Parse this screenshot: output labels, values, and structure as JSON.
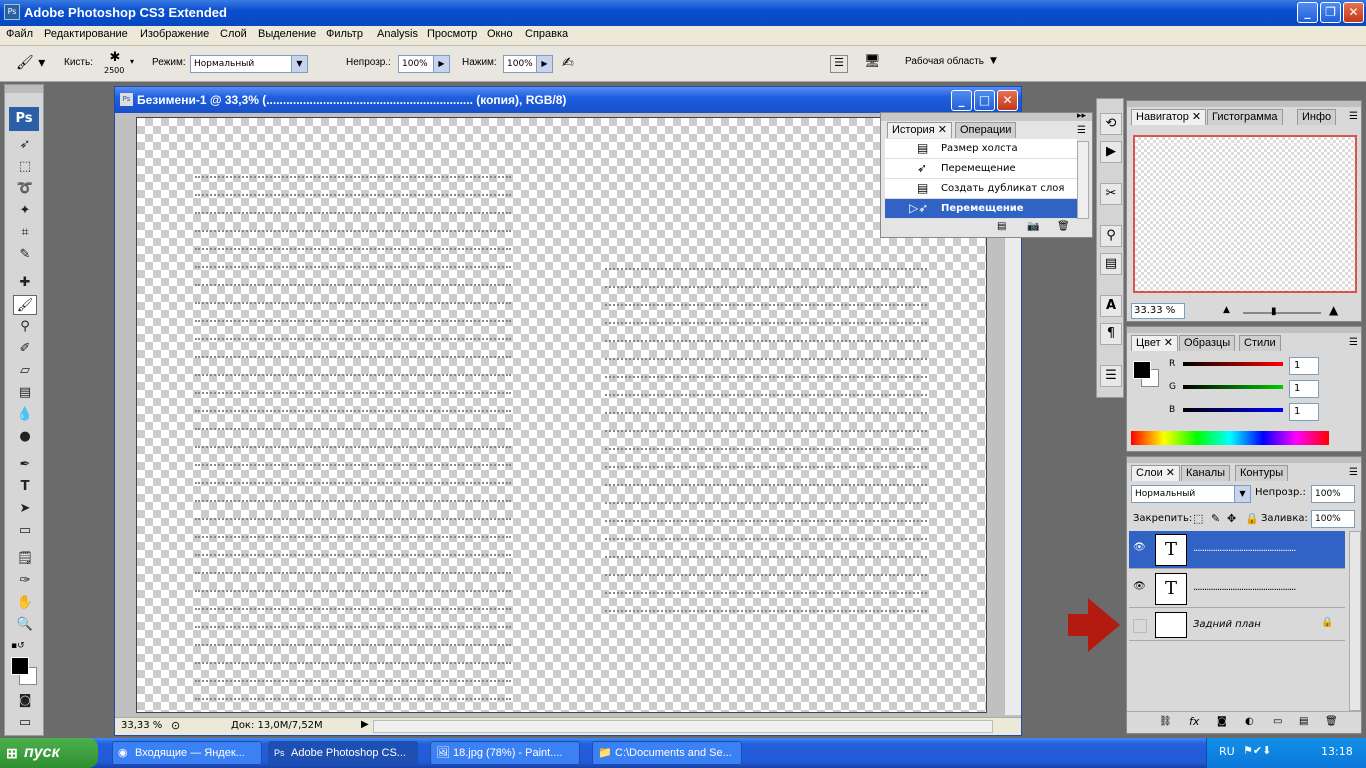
{
  "window": {
    "title": "Adobe Photoshop CS3 Extended",
    "logo": "Ps"
  },
  "menu": [
    "Файл",
    "Редактирование",
    "Изображение",
    "Слой",
    "Выделение",
    "Фильтр",
    "Analysis",
    "Просмотр",
    "Окно",
    "Справка"
  ],
  "options": {
    "brush_label": "Кисть:",
    "brush_size": "2500",
    "mode_label": "Режим:",
    "mode_value": "Нормальный",
    "opacity_label": "Непрозр.:",
    "opacity_value": "100%",
    "flow_label": "Нажим:",
    "flow_value": "100%",
    "workspace": "Рабочая область"
  },
  "document": {
    "title": "Безимени-1 @ 33,3% (.............................................................. (копия), RGB/8)",
    "zoom": "33,33 %",
    "doc_info": "Док: 13,0M/7,52M"
  },
  "history": {
    "tabs": [
      "История",
      "Операции"
    ],
    "items": [
      {
        "label": "Размер холста",
        "selected": false
      },
      {
        "label": "Перемещение",
        "selected": false
      },
      {
        "label": "Создать дубликат слоя",
        "selected": false
      },
      {
        "label": "Перемещение",
        "selected": true
      }
    ]
  },
  "navigator": {
    "tabs": [
      "Навигатор",
      "Гистограмма",
      "Инфо"
    ],
    "zoom": "33.33 %"
  },
  "color": {
    "tabs": [
      "Цвет",
      "Образцы",
      "Стили"
    ],
    "channels": [
      {
        "name": "R",
        "value": "1",
        "color": "#ff0000"
      },
      {
        "name": "G",
        "value": "1",
        "color": "#00c000"
      },
      {
        "name": "B",
        "value": "1",
        "color": "#0000ff"
      }
    ]
  },
  "layers": {
    "tabs": [
      "Слои",
      "Каналы",
      "Контуры"
    ],
    "blend_mode": "Нормальный",
    "opacity_label": "Непрозр.:",
    "opacity": "100%",
    "lock_label": "Закрепить:",
    "fill_label": "Заливка:",
    "fill": "100%",
    "items": [
      {
        "thumb": "T",
        "name": "...............................................",
        "visible": true,
        "selected": true
      },
      {
        "thumb": "T",
        "name": "...............................................",
        "visible": true,
        "selected": false
      },
      {
        "thumb": "",
        "name": "Задний план",
        "visible": false,
        "selected": false
      }
    ]
  },
  "taskbar": {
    "start": "пуск",
    "items": [
      "Входящие — Яндек...",
      "Adobe Photoshop CS...",
      "18.jpg (78%) - Paint....",
      "C:\\Documents and Se..."
    ],
    "lang": "RU",
    "time": "13:18"
  },
  "colors": {
    "title_blue": "#0a4fd0",
    "selection": "#3163c5",
    "arrow_red": "#b31b10"
  }
}
